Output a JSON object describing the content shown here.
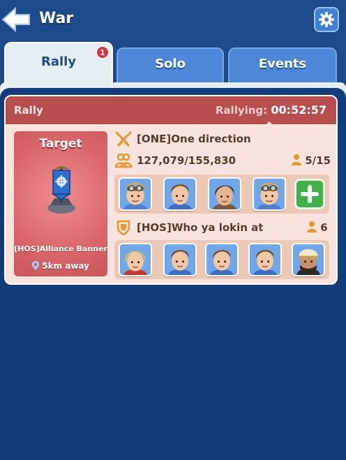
{
  "header": {
    "title": "War",
    "back_icon": "back-arrow-icon",
    "settings_icon": "gear-icon"
  },
  "tabs": [
    {
      "label": "Rally",
      "active": true,
      "badge": "1"
    },
    {
      "label": "Solo",
      "active": false
    },
    {
      "label": "Events",
      "active": false
    }
  ],
  "rally": {
    "header_label": "Rally",
    "rallying_label": "Rallying:",
    "rallying_time": "00:52:57",
    "target": {
      "title": "Target",
      "name": "[HOS]Alliance Banner",
      "distance": "5km away"
    },
    "attack_team": {
      "name": "[ONE]One direction",
      "power": "127,079/155,830",
      "members": "5/15",
      "heroes": [
        "hero-goggles",
        "hero-brown-hair",
        "hero-dark-hair",
        "hero-goggles"
      ],
      "add_label": "+"
    },
    "defense_team": {
      "name": "[HOS]Who ya lokin at",
      "members": "6",
      "heroes": [
        "hero-blonde",
        "hero-brown-hair",
        "hero-brown-hair",
        "hero-brown-hair",
        "hero-bandana"
      ]
    }
  },
  "colors": {
    "background": "#123d78",
    "card": "#f9e4dd",
    "card_header": "#b84f4f",
    "accent_orange": "#e8972a",
    "add_green": "#3fb34a"
  }
}
